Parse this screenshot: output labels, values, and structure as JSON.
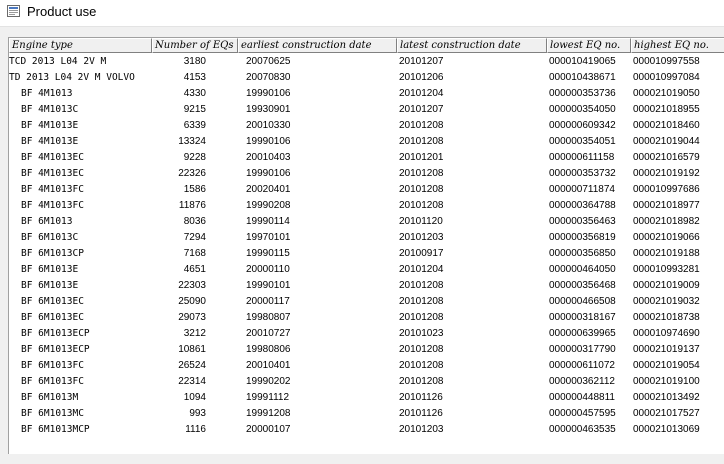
{
  "window": {
    "title": "Product use"
  },
  "table": {
    "columns": [
      {
        "key": "engine_type",
        "label": "Engine type"
      },
      {
        "key": "number_of_eqs",
        "label": "Number of EQs"
      },
      {
        "key": "earliest",
        "label": "earliest construction date"
      },
      {
        "key": "latest",
        "label": "latest construction date"
      },
      {
        "key": "lowest",
        "label": "lowest EQ no."
      },
      {
        "key": "highest",
        "label": "highest EQ no."
      }
    ],
    "rows": [
      {
        "engine_type": "TCD 2013 L04 2V M",
        "number_of_eqs": "3180",
        "earliest": "20070625",
        "latest": "20101207",
        "lowest": "000010419065",
        "highest": "000010997558"
      },
      {
        "engine_type": "TD 2013 L04 2V  M VOLVO",
        "number_of_eqs": "4153",
        "earliest": "20070830",
        "latest": "20101206",
        "lowest": "000010438671",
        "highest": "000010997084"
      },
      {
        "engine_type": "BF 4M1013",
        "number_of_eqs": "4330",
        "earliest": "19990106",
        "latest": "20101204",
        "lowest": "000000353736",
        "highest": "000021019050"
      },
      {
        "engine_type": "BF 4M1013C",
        "number_of_eqs": "9215",
        "earliest": "19930901",
        "latest": "20101207",
        "lowest": "000000354050",
        "highest": "000021018955"
      },
      {
        "engine_type": "BF 4M1013E",
        "number_of_eqs": "6339",
        "earliest": "20010330",
        "latest": "20101208",
        "lowest": "000000609342",
        "highest": "000021018460"
      },
      {
        "engine_type": "BF 4M1013E",
        "number_of_eqs": "13324",
        "earliest": "19990106",
        "latest": "20101208",
        "lowest": "000000354051",
        "highest": "000021019044"
      },
      {
        "engine_type": "BF 4M1013EC",
        "number_of_eqs": "9228",
        "earliest": "20010403",
        "latest": "20101201",
        "lowest": "000000611158",
        "highest": "000021016579"
      },
      {
        "engine_type": "BF 4M1013EC",
        "number_of_eqs": "22326",
        "earliest": "19990106",
        "latest": "20101208",
        "lowest": "000000353732",
        "highest": "000021019192"
      },
      {
        "engine_type": "BF 4M1013FC",
        "number_of_eqs": "1586",
        "earliest": "20020401",
        "latest": "20101208",
        "lowest": "000000711874",
        "highest": "000010997686"
      },
      {
        "engine_type": "BF 4M1013FC",
        "number_of_eqs": "11876",
        "earliest": "19990208",
        "latest": "20101208",
        "lowest": "000000364788",
        "highest": "000021018977"
      },
      {
        "engine_type": "BF 6M1013",
        "number_of_eqs": "8036",
        "earliest": "19990114",
        "latest": "20101120",
        "lowest": "000000356463",
        "highest": "000021018982"
      },
      {
        "engine_type": "BF 6M1013C",
        "number_of_eqs": "7294",
        "earliest": "19970101",
        "latest": "20101203",
        "lowest": "000000356819",
        "highest": "000021019066"
      },
      {
        "engine_type": "BF 6M1013CP",
        "number_of_eqs": "7168",
        "earliest": "19990115",
        "latest": "20100917",
        "lowest": "000000356850",
        "highest": "000021019188"
      },
      {
        "engine_type": "BF 6M1013E",
        "number_of_eqs": "4651",
        "earliest": "20000110",
        "latest": "20101204",
        "lowest": "000000464050",
        "highest": "000010993281"
      },
      {
        "engine_type": "BF 6M1013E",
        "number_of_eqs": "22303",
        "earliest": "19990101",
        "latest": "20101208",
        "lowest": "000000356468",
        "highest": "000021019009"
      },
      {
        "engine_type": "BF 6M1013EC",
        "number_of_eqs": "25090",
        "earliest": "20000117",
        "latest": "20101208",
        "lowest": "000000466508",
        "highest": "000021019032"
      },
      {
        "engine_type": "BF 6M1013EC",
        "number_of_eqs": "29073",
        "earliest": "19980807",
        "latest": "20101208",
        "lowest": "000000318167",
        "highest": "000021018738"
      },
      {
        "engine_type": "BF 6M1013ECP",
        "number_of_eqs": "3212",
        "earliest": "20010727",
        "latest": "20101023",
        "lowest": "000000639965",
        "highest": "000010974690"
      },
      {
        "engine_type": "BF 6M1013ECP",
        "number_of_eqs": "10861",
        "earliest": "19980806",
        "latest": "20101208",
        "lowest": "000000317790",
        "highest": "000021019137"
      },
      {
        "engine_type": "BF 6M1013FC",
        "number_of_eqs": "26524",
        "earliest": "20010401",
        "latest": "20101208",
        "lowest": "000000611072",
        "highest": "000021019054"
      },
      {
        "engine_type": "BF 6M1013FC",
        "number_of_eqs": "22314",
        "earliest": "19990202",
        "latest": "20101208",
        "lowest": "000000362112",
        "highest": "000021019100"
      },
      {
        "engine_type": "BF 6M1013M",
        "number_of_eqs": "1094",
        "earliest": "19991112",
        "latest": "20101126",
        "lowest": "000000448811",
        "highest": "000021013492"
      },
      {
        "engine_type": "BF 6M1013MC",
        "number_of_eqs": "993",
        "earliest": "19991208",
        "latest": "20101126",
        "lowest": "000000457595",
        "highest": "000021017527"
      },
      {
        "engine_type": "BF 6M1013MCP",
        "number_of_eqs": "1116",
        "earliest": "20000107",
        "latest": "20101203",
        "lowest": "000000463535",
        "highest": "000021013069"
      }
    ]
  }
}
